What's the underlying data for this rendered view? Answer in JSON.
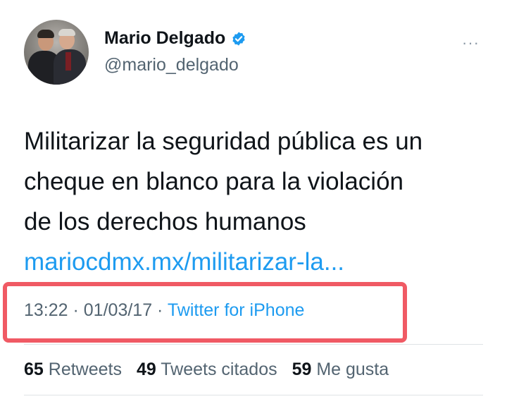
{
  "user": {
    "name": "Mario Delgado",
    "handle": "@mario_delgado"
  },
  "tweet": {
    "text_lines": [
      "Militarizar la seguridad pública es un",
      "cheque en blanco para la violación",
      "de los derechos humanos"
    ],
    "link": "mariocdmx.mx/militarizar-la..."
  },
  "meta": {
    "time": "13:22",
    "sep1": " · ",
    "date": "01/03/17",
    "sep2": " · ",
    "source": "Twitter for iPhone"
  },
  "stats": {
    "retweets_count": "65",
    "retweets_label": "Retweets",
    "quotes_count": "49",
    "quotes_label": "Tweets citados",
    "likes_count": "59",
    "likes_label": "Me gusta"
  },
  "icons": {
    "verified": "verified-badge-icon",
    "more": "more-options-icon"
  },
  "colors": {
    "link": "#1d9bf0",
    "highlight_box": "#f05a64",
    "secondary_text": "#536471"
  }
}
